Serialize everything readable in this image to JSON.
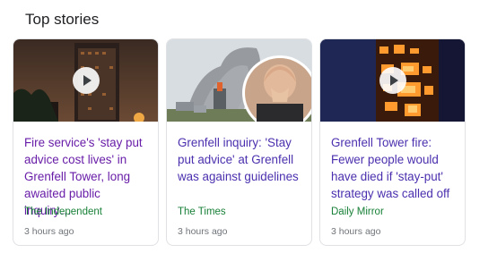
{
  "section": {
    "title": "Top stories"
  },
  "stories": [
    {
      "headline": "Fire service's 'stay put advice cost lives' in Grenfell Tower, long awaited public inquiry…",
      "source": "The Independent",
      "time": "3 hours ago",
      "has_video": true
    },
    {
      "headline": "Grenfell inquiry: 'Stay put advice' at Grenfell was against guidelines",
      "source": "The Times",
      "time": "3 hours ago",
      "has_video": false
    },
    {
      "headline": "Grenfell Tower fire: Fewer people would have died if 'stay-put' strategy was called off",
      "source": "Daily Mirror",
      "time": "3 hours ago",
      "has_video": true
    }
  ],
  "colors": {
    "visited_link": "#681da8",
    "link": "#4b2fae",
    "source": "#188038",
    "meta": "#70757a"
  }
}
